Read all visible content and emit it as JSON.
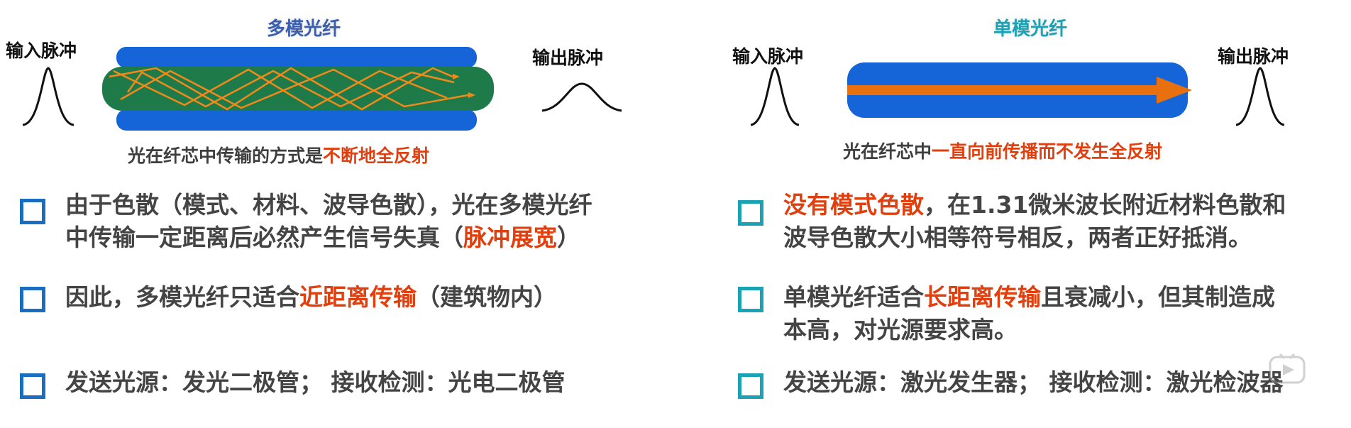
{
  "multimode": {
    "title": "多模光纤",
    "title_color": "#3a5fb0",
    "input_label": "输入脉冲",
    "output_label": "输出脉冲",
    "caption_prefix": "光在纤芯中传输的方式是",
    "caption_highlight": "不断地全反射",
    "cladding_color": "#1565d8",
    "core_color": "#1f7a4a",
    "ray_color": "#f08a1a"
  },
  "singlemode": {
    "title": "单模光纤",
    "title_color": "#1aa2b5",
    "input_label": "输入脉冲",
    "output_label": "输出脉冲",
    "caption_prefix": "光在纤芯中",
    "caption_highlight": "一直向前传播而不发生全反射",
    "cladding_color": "#1565d8",
    "ray_color": "#e8700f"
  },
  "left_points": [
    {
      "line1": "由于色散（模式、材料、波导色散），光在多模光纤",
      "line2_prefix": "中传输一定距离后必然产生信号失真（",
      "line2_highlight": "脉冲展宽",
      "line2_suffix": "）"
    },
    {
      "prefix": "因此，多模光纤只适合",
      "highlight": "近距离传输",
      "suffix": "（建筑物内）"
    },
    {
      "text": "发送光源：发光二极管； 接收检测：光电二极管"
    }
  ],
  "right_points": [
    {
      "line1_highlight": "没有模式色散",
      "line1_suffix": "，在1.31微米波长附近材料色散和",
      "line2": "波导色散大小相等符号相反，两者正好抵消。"
    },
    {
      "line1_prefix": "单模光纤适合",
      "line1_highlight": "长距离传输",
      "line1_suffix": "且衰减小，但其制造成",
      "line2": "本高，对光源要求高。"
    },
    {
      "text": "发送光源：激光发生器； 接收检测：激光检波器"
    }
  ],
  "colors": {
    "highlight": "#e0400f",
    "bullet_left": "#1a6ec2",
    "bullet_right": "#1aa2b5"
  },
  "icons": {
    "watermark": "video-watermark-icon"
  }
}
